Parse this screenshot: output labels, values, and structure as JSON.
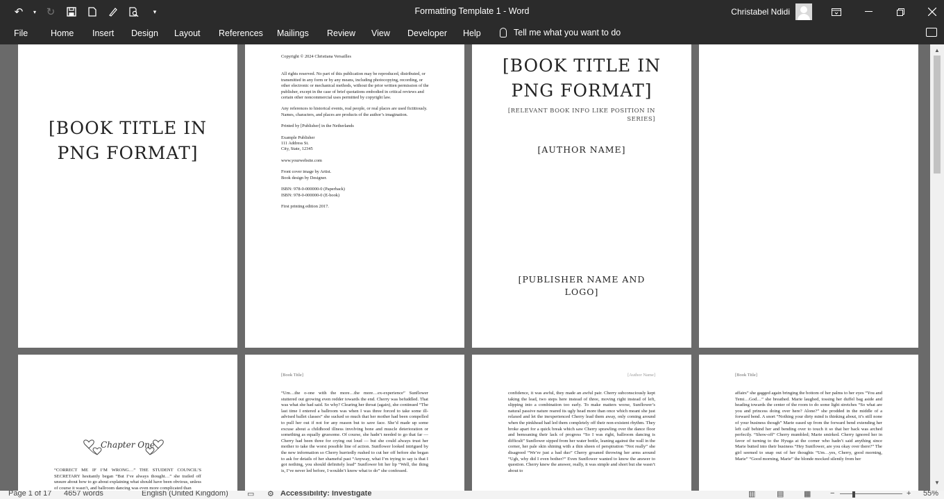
{
  "window": {
    "title": "Formatting Template 1  -  Word",
    "user": "Christabel Ndidi"
  },
  "menu": {
    "tabs": [
      "File",
      "Home",
      "Insert",
      "Design",
      "Layout",
      "References",
      "Mailings",
      "Review",
      "View",
      "Developer",
      "Help"
    ],
    "tell_me": "Tell me what you want to do"
  },
  "pages": {
    "p1": {
      "title_line1": "[BOOK TITLE IN",
      "title_line2": "PNG FORMAT]"
    },
    "p2": {
      "copyright": "Copyright © 2024 Christiana Versailles",
      "rights": "All rights reserved. No part of this publication may be reproduced, distributed, or transmitted in any form or by any means, including photocopying, recording, or other electronic or mechanical methods, without the prior written permission of the publisher, except in the case of brief quotations embodied in critical reviews and certain other noncommercial uses permitted by copyright law.",
      "fiction": "Any references to historical events, real people, or real places are used fictitiously. Names, characters, and places are products of the author’s imagination.",
      "printed": "Printed by [Publisher] in the Netherlands",
      "pub_name": "Example Publisher",
      "pub_addr1": "111 Address St.",
      "pub_addr2": "City, State, 12345",
      "website": "www.yourwebsite.com",
      "cover": "Front cover image by Artist.",
      "design": "Book design by Designer.",
      "isbn1": "ISBN: 978-0-000000-0 (Paperback)",
      "isbn2": "ISBN: 978-0-000000-0 (E-book)",
      "edition": "First printing edition 2017."
    },
    "p3": {
      "title_line1": "[BOOK TITLE IN",
      "title_line2": "PNG FORMAT]",
      "info_line1": "[RELEVANT BOOK INFO LIKE POSITION IN",
      "info_line2": "SERIES]",
      "author": "[AUTHOR NAME]",
      "publisher_line1": "[PUBLISHER NAME AND",
      "publisher_line2": "LOGO]"
    },
    "p5": {
      "chapter": "Chapter One",
      "text": "“CORRECT ME IF I’M WRONG…” THE STUDENT COUNCIL’S SECRETARY hesitantly began “But I’ve always thought…” she trailed off unsure about how to go about explaining what should have been obvious, unless of course it wasn’t, and ballroom dancing was even more complicated than"
    },
    "p6": {
      "header": "[Book Title]",
      "text": "“Um…the o-one with the more…the more…ex-experience” Sunflower stuttered out growing even redder towards the end. Cherry was befuddled. That was what she had said. So why? Clearing her throat (again), she continued “The last time I entered a ballroom was when I was three forced to take some ill-advised ballet classes” she sucked so much that her mother had been compelled to pull her out if not for any reason but to save face. She’d made up some excuse about a childhood illness involving bone and muscle deterioration or something as equally gruesome. Of course, she hadn’t needed to go that far — Cherry had been three for crying out loud — but she could always trust her mother to take the worst possible line of action. Sunflower looked intrigued by the new information so Cherry hurriedly rushed to cut her off before she began to ask for details of her shameful past “Anyway, what I’m trying to say is that I got nothing, you should definitely lead” Sunflower bit her lip “Well, the thing is, I’ve never led before, I wouldn’t know what to do” she confessed."
    },
    "p7": {
      "header": "[Author Name]",
      "text": "confidence, it was awful, they made an awful pair. Cherry subconsciously kept taking the lead, two steps here instead of three, moving right instead of left, slipping into a combination too early. To make matters worse, Sunflower’s natural passive nature reared its ugly head more than once which meant she just relaxed and let the inexperienced Cherry lead them away, only coming around when the pinkhead had led them completely off their non-existent rhythm. They broke apart for a quick break which saw Cherry sprawling over the dance floor and bemoaning their lack of progress “So I was right, ballroom dancing is difficult” Sunflower sipped from her water bottle, leaning against the wall in the corner, her pale skin shining with a thin sheen of perspiration “Not really” she disagreed “We’re just a bad duo” Cherry groaned throwing her arms around “Ugh, why did I even bother?” Even Sunflower wanted to know the answer to question. Cherry knew the answer, really, it was simple and short but she wasn’t about to"
    },
    "p8": {
      "header": "[Book Title]",
      "text": "affairs” she gagged again bringing the bottom of her palms to her eyes “You and Temi…God…” she breathed. Marie laughed, tossing her duffel bag aside and heading towards the center of the room to do some light stretches “So what are you and princess doing over here? Alone?” she prodded in the middle of a forward bend. A snort “Nothing your dirty mind is thinking about, it’s still none of your business though” Marie eased up from the forward bend extending her left calf behind her and bending over to touch it so that her back was arched perfectly. “Show-off” Cherry mumbled; Marie smirked. Cherry ignored her in favor of turning to the Hyuga at the corner who hadn’t said anything since Marie butted into their business “Hey Sunflower, are you okay over there?” The girl seemed to snap out of her thoughts “Um…yes, Cherry, good morning, Marie” “Good morning, Marie” the blonde mocked silently from her"
    }
  },
  "status": {
    "page": "Page 1 of 17",
    "words": "4657 words",
    "language": "English (United Kingdom)",
    "accessibility": "Accessibility: Investigate",
    "zoom": "55%"
  }
}
